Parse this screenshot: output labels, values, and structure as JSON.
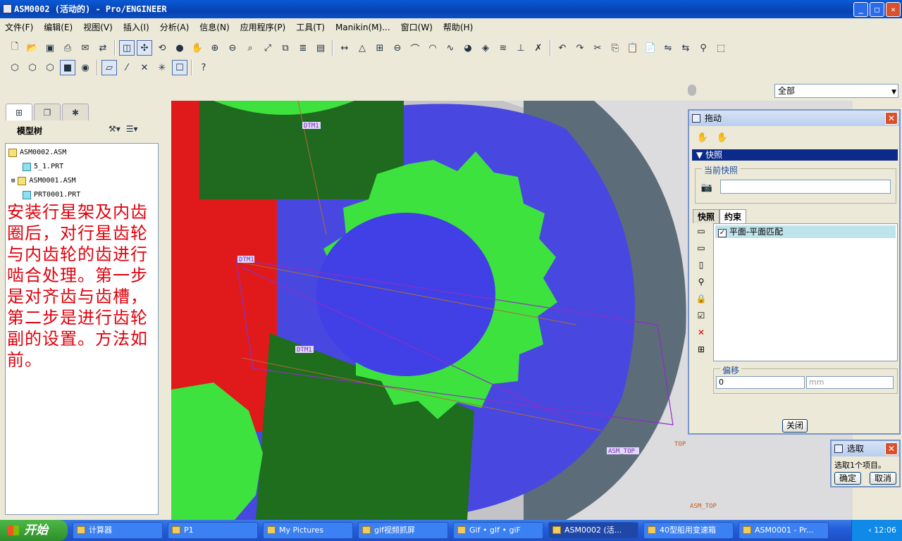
{
  "window": {
    "title": "ASM0002 (活动的) - Pro/ENGINEER",
    "minimize": "_",
    "maximize": "□",
    "close": "✕"
  },
  "menu": [
    "文件(F)",
    "编辑(E)",
    "视图(V)",
    "插入(I)",
    "分析(A)",
    "信息(N)",
    "应用程序(P)",
    "工具(T)",
    "Manikin(M)...",
    "窗口(W)",
    "帮助(H)"
  ],
  "filter": {
    "value": "全部"
  },
  "model_tree": {
    "header": "模型树",
    "items": [
      {
        "label": "ASM0002.ASM",
        "kind": "asm"
      },
      {
        "label": "5_1.PRT",
        "kind": "prt"
      },
      {
        "label": "ASM0001.ASM",
        "kind": "asm"
      },
      {
        "label": "PRT0001.PRT",
        "kind": "prt"
      }
    ]
  },
  "annotation": "安装行星架及内齿圈后，对行星齿轮与内齿轮的齿进行啮合处理。第一步是对齐齿与齿槽，第二步是进行齿轮副的设置。方法如前。",
  "viewport_labels": {
    "dtm1_top": "DTM1",
    "dtm1_mid": "DTM1",
    "dtm1_low": "DTM1",
    "asm_top_1": "ASM_TOP",
    "asm_top_2": "ASM_TOP",
    "top": "TOP"
  },
  "drag_dialog": {
    "title": "拖动",
    "section": "快照",
    "current_snapshot_label": "当前快照",
    "snapshot_value": "",
    "tabs": [
      "快照",
      "约束"
    ],
    "active_tab": "约束",
    "constraint": {
      "label": "平面-平面匹配",
      "checked": true
    },
    "offset_label": "偏移",
    "offset_value": "0",
    "offset_unit": "mm",
    "close_button": "关闭"
  },
  "select_dialog": {
    "title": "选取",
    "message": "选取1个项目。",
    "ok": "确定",
    "cancel": "取消"
  },
  "taskbar": {
    "start": "开始",
    "tasks": [
      "计算器",
      "P1",
      "My Pictures",
      "gif视频抓屏",
      "Gif • gIf • giF",
      "ASM0002 (活...",
      "40型船用变速箱",
      "ASM0001 - Pr..."
    ],
    "active_task": "ASM0002 (活...",
    "clock": "12:06"
  },
  "colors": {
    "gear_green": "#3ee23e",
    "hub_blue": "#4040e6",
    "gear_red": "#e01212",
    "datum_purple": "#8b2fc9"
  }
}
